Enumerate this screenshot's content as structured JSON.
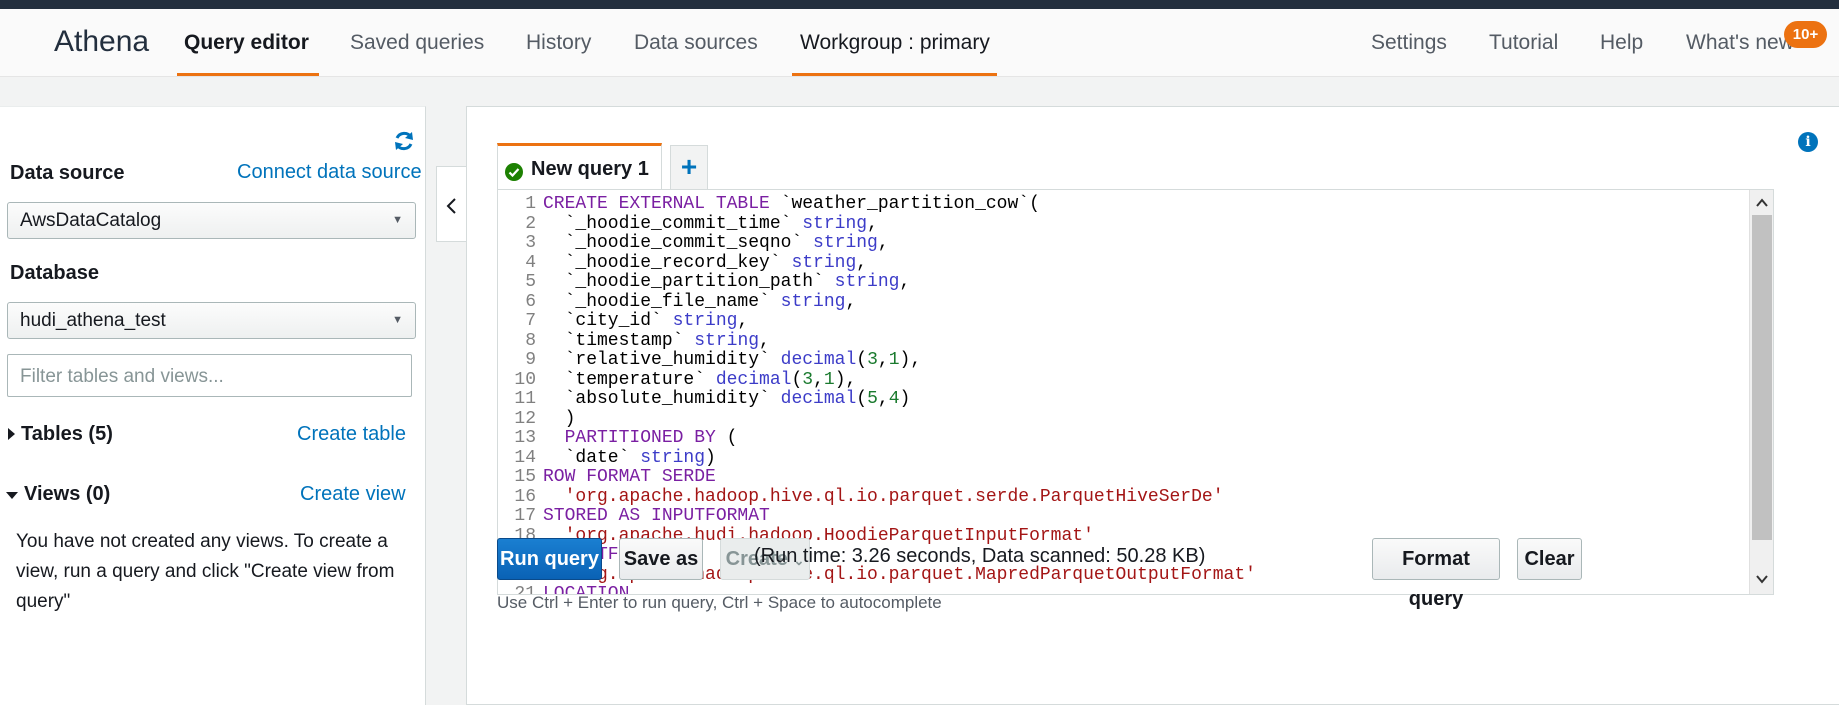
{
  "nav": {
    "brand": "Athena",
    "items": [
      {
        "label": "Query editor",
        "active": true
      },
      {
        "label": "Saved queries"
      },
      {
        "label": "History"
      },
      {
        "label": "Data sources"
      },
      {
        "label": "Workgroup : primary",
        "underlined": true
      }
    ],
    "right_items": [
      {
        "label": "Settings"
      },
      {
        "label": "Tutorial"
      },
      {
        "label": "Help"
      },
      {
        "label": "What's new"
      }
    ],
    "badge": "10+"
  },
  "sidebar": {
    "data_source_label": "Data source",
    "connect_link": "Connect data source",
    "data_source_value": "AwsDataCatalog",
    "database_label": "Database",
    "database_value": "hudi_athena_test",
    "filter_placeholder": "Filter tables and views...",
    "tables_label": "Tables (5)",
    "create_table_link": "Create table",
    "views_label": "Views (0)",
    "create_view_link": "Create view",
    "views_empty_message": "You have not created any views. To create a view, run a query and click \"Create view from query\""
  },
  "editor": {
    "tab_label": "New query 1",
    "add_tab": "+",
    "lines": [
      [
        [
          "kw",
          "CREATE EXTERNAL TABLE"
        ],
        [
          "id",
          " `weather_partition_cow`("
        ]
      ],
      [
        [
          "id",
          "  `_hoodie_commit_time` "
        ],
        [
          "ty",
          "string"
        ],
        [
          "id",
          ","
        ]
      ],
      [
        [
          "id",
          "  `_hoodie_commit_seqno` "
        ],
        [
          "ty",
          "string"
        ],
        [
          "id",
          ","
        ]
      ],
      [
        [
          "id",
          "  `_hoodie_record_key` "
        ],
        [
          "ty",
          "string"
        ],
        [
          "id",
          ","
        ]
      ],
      [
        [
          "id",
          "  `_hoodie_partition_path` "
        ],
        [
          "ty",
          "string"
        ],
        [
          "id",
          ","
        ]
      ],
      [
        [
          "id",
          "  `_hoodie_file_name` "
        ],
        [
          "ty",
          "string"
        ],
        [
          "id",
          ","
        ]
      ],
      [
        [
          "id",
          "  `city_id` "
        ],
        [
          "ty",
          "string"
        ],
        [
          "id",
          ","
        ]
      ],
      [
        [
          "id",
          "  `timestamp` "
        ],
        [
          "ty",
          "string"
        ],
        [
          "id",
          ","
        ]
      ],
      [
        [
          "id",
          "  `relative_humidity` "
        ],
        [
          "ty",
          "decimal"
        ],
        [
          "id",
          "("
        ],
        [
          "nm",
          "3"
        ],
        [
          "id",
          ","
        ],
        [
          "nm",
          "1"
        ],
        [
          "id",
          "),"
        ]
      ],
      [
        [
          "id",
          "  `temperature` "
        ],
        [
          "ty",
          "decimal"
        ],
        [
          "id",
          "("
        ],
        [
          "nm",
          "3"
        ],
        [
          "id",
          ","
        ],
        [
          "nm",
          "1"
        ],
        [
          "id",
          "),"
        ]
      ],
      [
        [
          "id",
          "  `absolute_humidity` "
        ],
        [
          "ty",
          "decimal"
        ],
        [
          "id",
          "("
        ],
        [
          "nm",
          "5"
        ],
        [
          "id",
          ","
        ],
        [
          "nm",
          "4"
        ],
        [
          "id",
          ")"
        ]
      ],
      [
        [
          "id",
          "  )"
        ]
      ],
      [
        [
          "kw",
          "  PARTITIONED BY"
        ],
        [
          "id",
          " ("
        ]
      ],
      [
        [
          "id",
          "  `date` "
        ],
        [
          "ty",
          "string"
        ],
        [
          "id",
          ")"
        ]
      ],
      [
        [
          "kw",
          "ROW FORMAT SERDE"
        ]
      ],
      [
        [
          "st",
          "  'org.apache.hadoop.hive.ql.io.parquet.serde.ParquetHiveSerDe'"
        ]
      ],
      [
        [
          "kw",
          "STORED AS INPUTFORMAT"
        ]
      ],
      [
        [
          "st",
          "  'org.apache.hudi.hadoop.HoodieParquetInputFormat'"
        ]
      ],
      [
        [
          "kw",
          "OUTPUTFORMAT"
        ]
      ],
      [
        [
          "st",
          "  'org.apache.hadoop.hive.ql.io.parquet.MapredParquetOutputFormat'"
        ]
      ],
      [
        [
          "kw",
          "LOCATION"
        ]
      ]
    ]
  },
  "actions": {
    "run_query": "Run query",
    "save_as": "Save as",
    "create": "Create",
    "run_info": "(Run time: 3.26 seconds, Data scanned: 50.28 KB)",
    "format_query": "Format query",
    "clear": "Clear",
    "hint": "Use Ctrl + Enter to run query, Ctrl + Space to autocomplete"
  },
  "colors": {
    "accent": "#ec7211",
    "link": "#0073bb",
    "primary_button": "#0a62b5",
    "keyword": "#7a1fa2",
    "type": "#3c3cc8",
    "number": "#1a7a2e",
    "string": "#a31515"
  }
}
